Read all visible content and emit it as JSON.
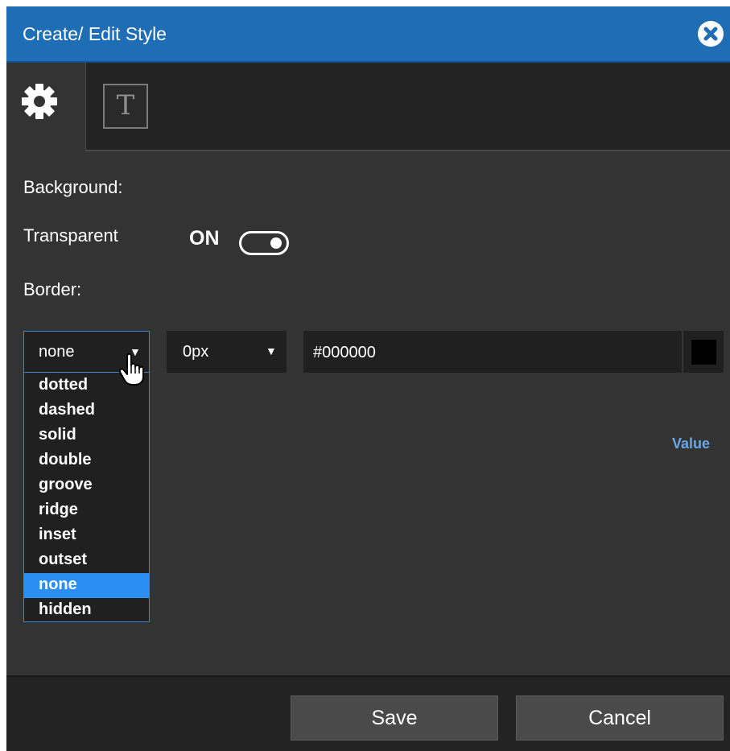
{
  "dialog": {
    "title": "Create/ Edit Style",
    "close_icon": "close-circle-icon"
  },
  "tabs": [
    {
      "icon": "gear-icon",
      "active": true
    },
    {
      "icon": "text-format-icon",
      "glyph": "T",
      "active": false
    }
  ],
  "form": {
    "background_label": "Background:",
    "transparent_label": "Transparent",
    "transparent_state": "ON",
    "border_label": "Border:",
    "border_style": {
      "selected": "none",
      "options": [
        "dotted",
        "dashed",
        "solid",
        "double",
        "groove",
        "ridge",
        "inset",
        "outset",
        "none",
        "hidden"
      ]
    },
    "border_width": "0px",
    "border_color": "#000000",
    "value_link": "Value"
  },
  "footer": {
    "save_label": "Save",
    "cancel_label": "Cancel"
  },
  "colors": {
    "title_bar": "#1f6db5",
    "selected_option": "#2a8ef2",
    "link": "#6aa7e6"
  }
}
